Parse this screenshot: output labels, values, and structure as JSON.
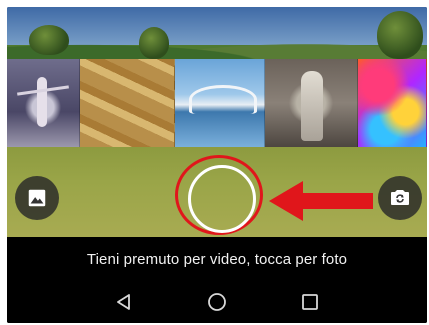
{
  "camera": {
    "hint_text": "Tieni premuto per video, tocca per foto",
    "thumbnails": [
      {
        "name": "ballerina",
        "icon": "ballerina-photo"
      },
      {
        "name": "old-pages",
        "icon": "book-pages-photo"
      },
      {
        "name": "modern-architecture",
        "icon": "architecture-photo"
      },
      {
        "name": "statue",
        "icon": "statue-photo"
      },
      {
        "name": "colorful-paint",
        "icon": "abstract-paint-photo"
      }
    ],
    "controls": {
      "gallery_icon": "image-gallery-icon",
      "shutter_icon": "shutter-button",
      "flip_icon": "camera-switch-icon"
    },
    "annotation_color": "#e0161b"
  },
  "navigation": {
    "back_icon": "back-triangle-icon",
    "home_icon": "home-circle-icon",
    "recents_icon": "recents-square-icon"
  }
}
